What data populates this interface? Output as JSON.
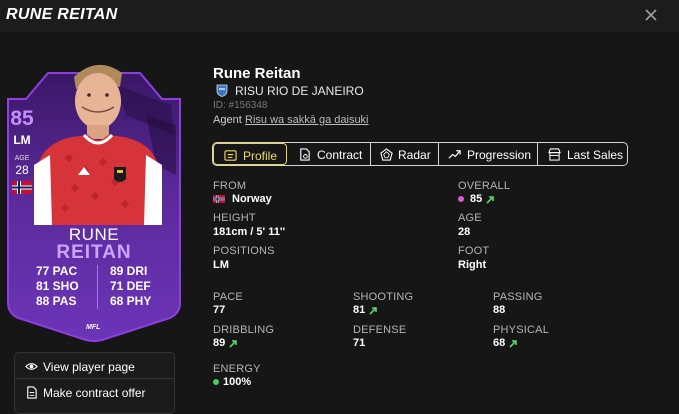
{
  "modal": {
    "title": "RUNE REITAN"
  },
  "card": {
    "overall": "85",
    "position": "LM",
    "age_label": "AGE",
    "age": "28",
    "first_name": "RUNE",
    "last_name": "REITAN",
    "logo_text": "MFL",
    "stats": [
      {
        "left": "77 PAC",
        "right": "89 DRI"
      },
      {
        "left": "81 SHO",
        "right": "71 DEF"
      },
      {
        "left": "88 PAS",
        "right": "68 PHY"
      }
    ]
  },
  "menu": {
    "view_label": "View player page",
    "contract_label": "Make contract offer"
  },
  "player": {
    "name": "Rune Reitan",
    "club": "RISU RIO DE JANEIRO",
    "id_text": "ID: #156348",
    "agent_label": "Agent",
    "agent_name": "Risu wa sakkā ga daisuki"
  },
  "tabs": [
    {
      "label": "Profile",
      "icon": "profile-card-icon",
      "active": true
    },
    {
      "label": "Contract",
      "icon": "contract-icon",
      "active": false
    },
    {
      "label": "Radar",
      "icon": "radar-icon",
      "active": false
    },
    {
      "label": "Progression",
      "icon": "trend-icon",
      "active": false
    },
    {
      "label": "Last Sales",
      "icon": "shop-icon",
      "active": false
    }
  ],
  "profile": {
    "from": {
      "label": "FROM",
      "value": "Norway"
    },
    "overall": {
      "label": "OVERALL",
      "value": "85"
    },
    "height": {
      "label": "HEIGHT",
      "value": "181cm / 5' 11''"
    },
    "age": {
      "label": "AGE",
      "value": "28"
    },
    "positions": {
      "label": "POSITIONS",
      "value": "LM"
    },
    "foot": {
      "label": "FOOT",
      "value": "Right"
    },
    "pace": {
      "label": "PACE",
      "value": "77"
    },
    "shooting": {
      "label": "SHOOTING",
      "value": "81"
    },
    "passing": {
      "label": "PASSING",
      "value": "88"
    },
    "dribbling": {
      "label": "DRIBBLING",
      "value": "89"
    },
    "defense": {
      "label": "DEFENSE",
      "value": "71"
    },
    "physical": {
      "label": "PHYSICAL",
      "value": "68"
    },
    "energy": {
      "label": "ENERGY",
      "value": "100%"
    }
  },
  "colors": {
    "accent_yellow": "#e8d25a",
    "card_purple": "#8e3fe0",
    "overall_dot": "#e05ad2",
    "energy_dot": "#4ccd5a",
    "up_arrow": "#5fd36b"
  }
}
